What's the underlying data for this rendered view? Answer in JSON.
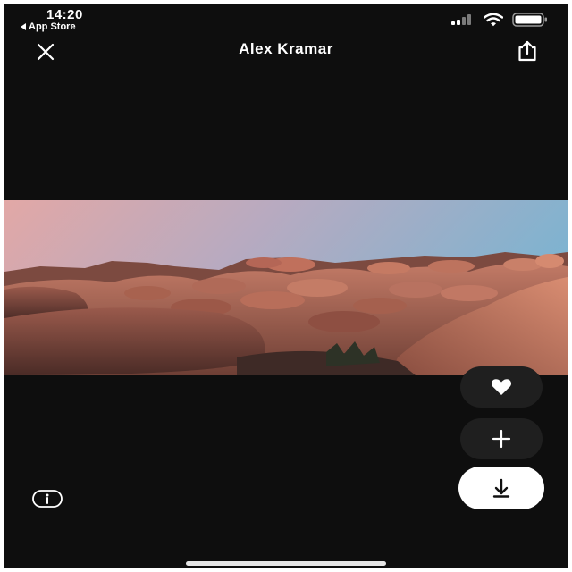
{
  "status_bar": {
    "time": "14:20",
    "back_app": "App Store",
    "signal_icon": "cellular-signal-icon",
    "wifi_icon": "wifi-icon",
    "battery_icon": "battery-icon"
  },
  "nav": {
    "close_icon": "close-icon",
    "title": "Alex Kramar",
    "share_icon": "share-icon"
  },
  "photo": {
    "subject": "desert-rock-formation-photo"
  },
  "actions": {
    "like_icon": "heart-icon",
    "add_icon": "plus-icon",
    "download_icon": "download-arrow-icon",
    "info_icon": "info-icon"
  },
  "colors": {
    "background": "#0e0e0e",
    "fab_dark": "#1f1f1f",
    "fab_light": "#ffffff",
    "text": "#ffffff"
  }
}
